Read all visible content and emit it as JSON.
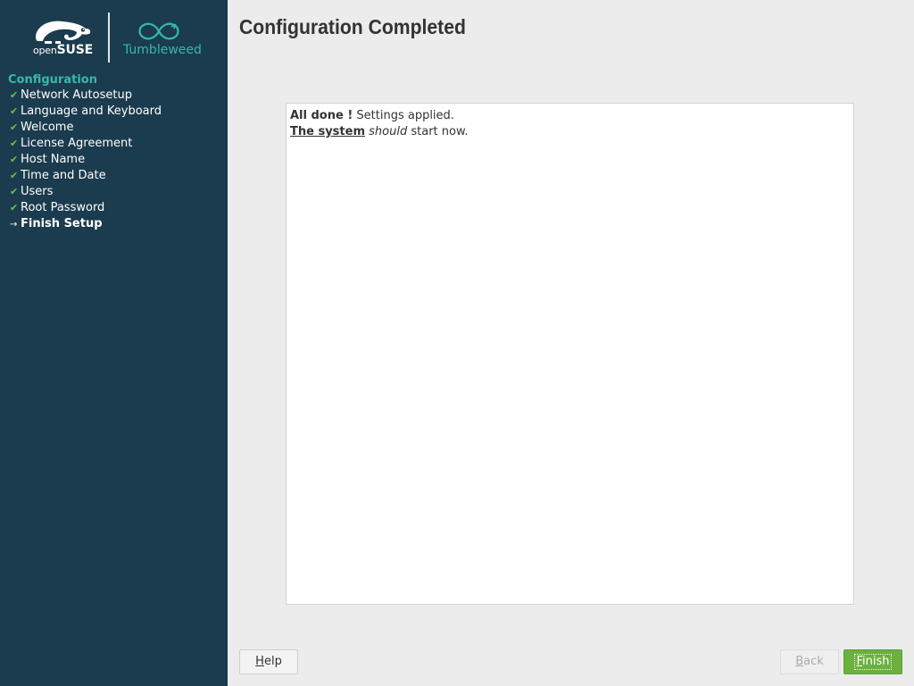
{
  "brand": {
    "distro_prefix": "open",
    "distro_name": "SUSE",
    "edition": "Tumbleweed",
    "accent_color": "#35b9ab",
    "sidebar_color": "#1b3b4e"
  },
  "sidebar": {
    "title": "Configuration",
    "items": [
      {
        "label": "Network Autosetup",
        "state": "done",
        "mark": "✔"
      },
      {
        "label": "Language and Keyboard",
        "state": "done",
        "mark": "✔"
      },
      {
        "label": "Welcome",
        "state": "done",
        "mark": "✔"
      },
      {
        "label": "License Agreement",
        "state": "done",
        "mark": "✔"
      },
      {
        "label": "Host Name",
        "state": "done",
        "mark": "✔"
      },
      {
        "label": "Time and Date",
        "state": "done",
        "mark": "✔"
      },
      {
        "label": "Users",
        "state": "done",
        "mark": "✔"
      },
      {
        "label": "Root Password",
        "state": "done",
        "mark": "✔"
      },
      {
        "label": "Finish Setup",
        "state": "current",
        "mark": "→"
      }
    ]
  },
  "main": {
    "title": "Configuration Completed",
    "message": {
      "line1_bold": "All done !",
      "line1_rest": " Settings applied.",
      "line2_bold_underlined": "The system",
      "line2_italic": "should",
      "line2_rest": " start now."
    }
  },
  "buttons": {
    "help": {
      "prefix": "",
      "mnemonic": "H",
      "suffix": "elp",
      "enabled": true
    },
    "back": {
      "prefix": "",
      "mnemonic": "B",
      "suffix": "ack",
      "enabled": false
    },
    "finish": {
      "prefix": "",
      "mnemonic": "F",
      "suffix": "inish",
      "enabled": true
    }
  }
}
